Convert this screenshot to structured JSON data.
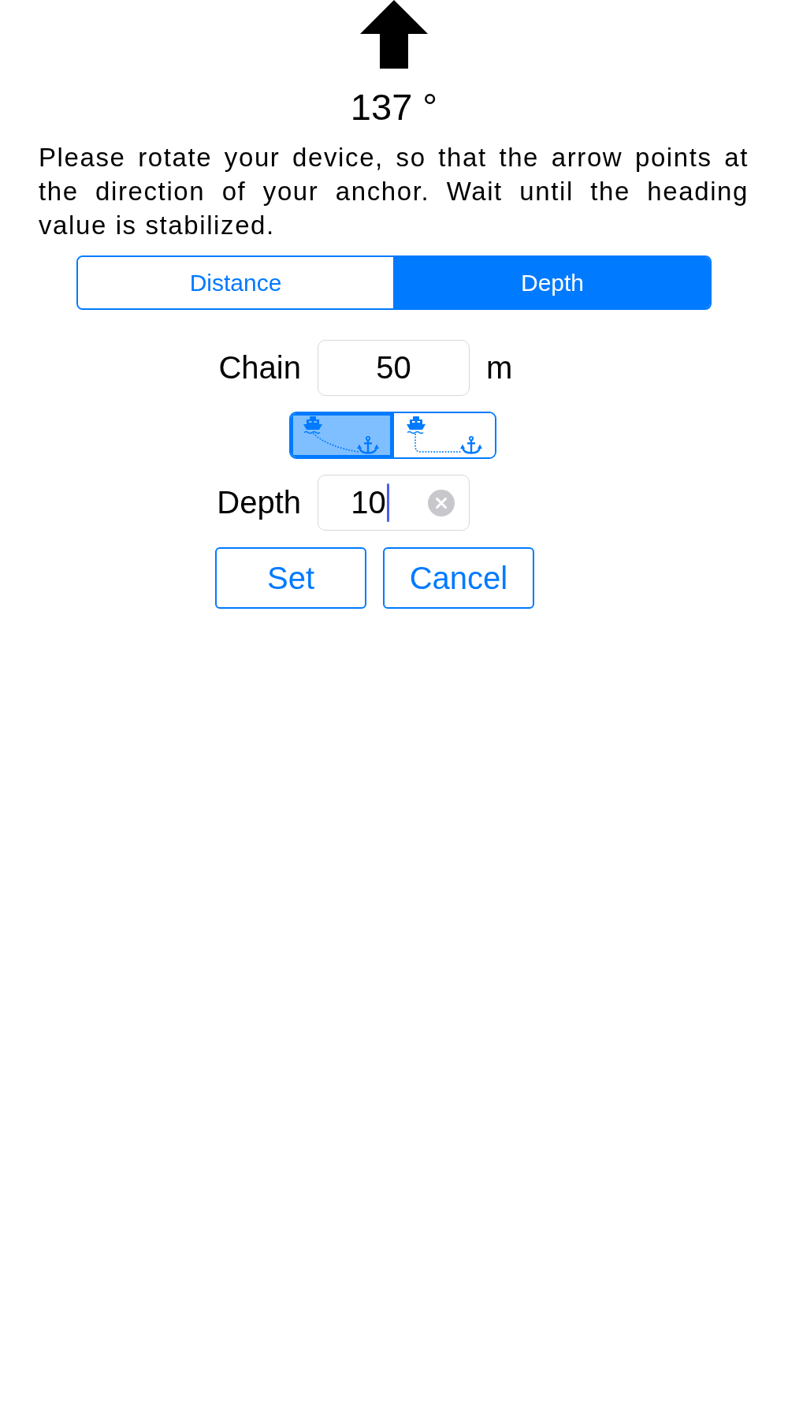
{
  "compass": {
    "heading": "137 °"
  },
  "instructions": "Please rotate your device, so that the arrow points at the direction of your anchor. Wait until the heading value is stabilized.",
  "mode_tabs": [
    {
      "label": "Distance",
      "selected": false
    },
    {
      "label": "Depth",
      "selected": true
    }
  ],
  "chain": {
    "label": "Chain",
    "value": "50",
    "unit": "m"
  },
  "rode_shape": [
    {
      "kind": "diagonal",
      "selected": true
    },
    {
      "kind": "vertical",
      "selected": false
    }
  ],
  "depth": {
    "label": "Depth",
    "value": "10",
    "focused": true
  },
  "buttons": [
    "Set",
    "Cancel"
  ]
}
